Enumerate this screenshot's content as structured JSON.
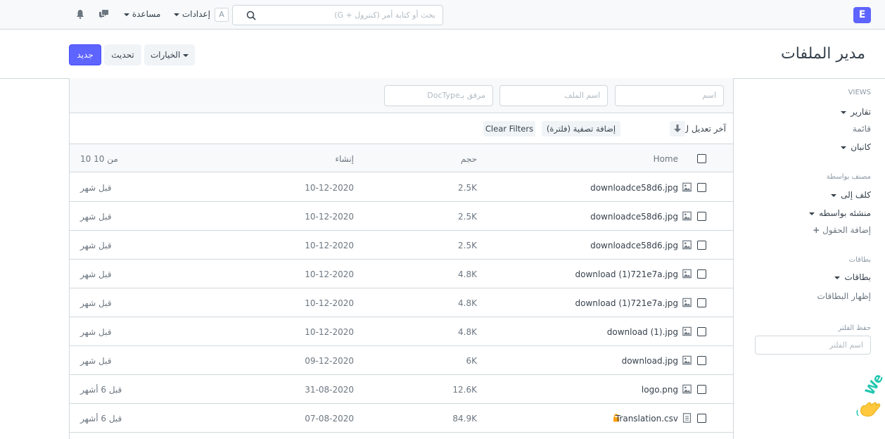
{
  "navbar": {
    "brand_letter": "E",
    "search_placeholder": "بحث أو كتابة أمر (كنترول + G)",
    "avatar_letter": "A",
    "settings_label": "إعدادات",
    "help_label": "مساعدة"
  },
  "page": {
    "title": "مدير الملفات",
    "new_button": "جديد",
    "refresh_button": "تحديث",
    "options_button": "الخيارات"
  },
  "filters": {
    "name_placeholder": "اسم",
    "file_name_placeholder": "اسم الملف",
    "attached_to_placeholder": "مرفق بـDocType",
    "sort_label": "آخر تعديل ل",
    "add_filter": "إضافة تصفية (فلترة)",
    "clear_filters": "Clear Filters"
  },
  "table": {
    "headers": {
      "name": "Home",
      "size": "حجم",
      "created": "إنشاء",
      "count": "10 من 10"
    },
    "rows": [
      {
        "name": "downloadce58d6.jpg",
        "size": "2.5K",
        "created": "10-12-2020",
        "modified": "قبل شهر",
        "icon": "image-icon",
        "locked": false
      },
      {
        "name": "downloadce58d6.jpg",
        "size": "2.5K",
        "created": "10-12-2020",
        "modified": "قبل شهر",
        "icon": "image-icon",
        "locked": false
      },
      {
        "name": "downloadce58d6.jpg",
        "size": "2.5K",
        "created": "10-12-2020",
        "modified": "قبل شهر",
        "icon": "image-icon",
        "locked": false
      },
      {
        "name": "download (1)721e7a.jpg",
        "size": "4.8K",
        "created": "10-12-2020",
        "modified": "قبل شهر",
        "icon": "image-icon",
        "locked": false
      },
      {
        "name": "download (1)721e7a.jpg",
        "size": "4.8K",
        "created": "10-12-2020",
        "modified": "قبل شهر",
        "icon": "image-icon",
        "locked": false
      },
      {
        "name": "download (1).jpg",
        "size": "4.8K",
        "created": "10-12-2020",
        "modified": "قبل شهر",
        "icon": "image-icon",
        "locked": false
      },
      {
        "name": "download.jpg",
        "size": "6K",
        "created": "09-12-2020",
        "modified": "قبل شهر",
        "icon": "image-icon",
        "locked": false
      },
      {
        "name": "logo.png",
        "size": "12.6K",
        "created": "31-08-2020",
        "modified": "قبل 6 أشهر",
        "icon": "image-icon",
        "locked": false
      },
      {
        "name": "Translation.csv",
        "size": "84.9K",
        "created": "07-08-2020",
        "modified": "قبل 6 أشهر",
        "icon": "document-icon",
        "locked": true
      }
    ]
  },
  "sidebar": {
    "views_heading": "VIEWS",
    "reports": "تقارير",
    "list": "قائمة",
    "kanban": "كانبان",
    "classified_by_heading": "مصنف بواسطة",
    "assigned_to": "كلف إلى",
    "created_by": "منشئه بواسطه",
    "add_fields": "إضافة الحقول",
    "tags_heading": "بطاقات",
    "tags": "بطاقات",
    "show_tags": "إظهار البطاقات",
    "save_filter_heading": "حفظ الفلتر",
    "filter_name_placeholder": "اسم الفلتر"
  },
  "colors": {
    "primary": "#5e64ff",
    "border": "#d1d8dd",
    "lock": "#ffa00a"
  }
}
